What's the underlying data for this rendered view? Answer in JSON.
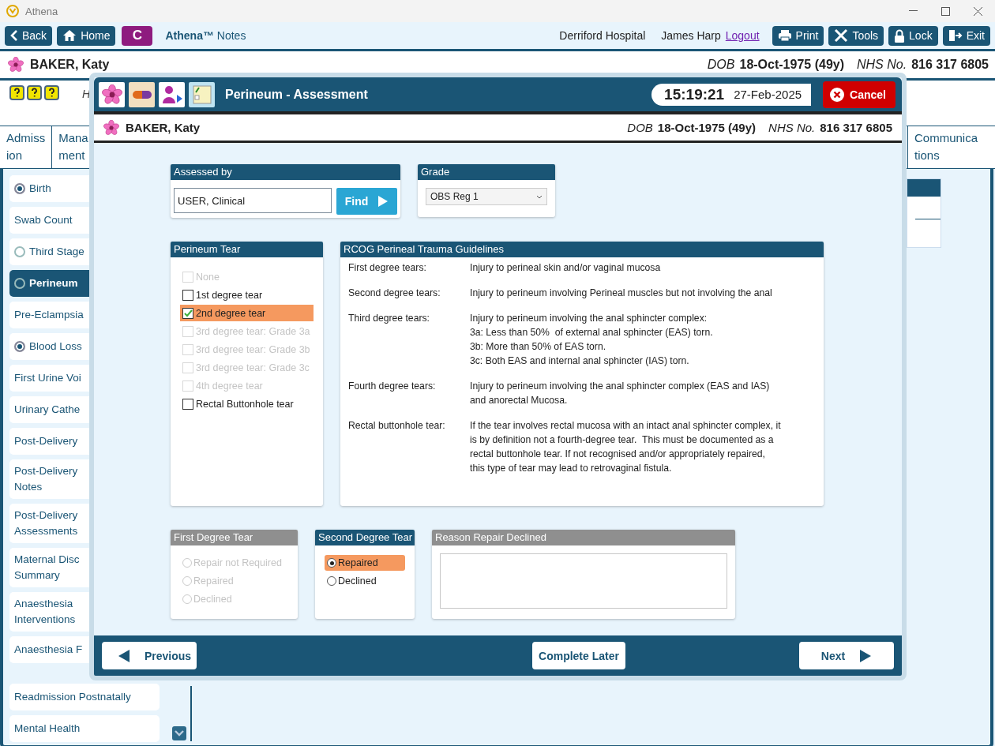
{
  "app_title": "Athena",
  "toolbar": {
    "nav_buttons": [
      {
        "label": "Back"
      },
      {
        "label": "Home"
      }
    ],
    "c_button": "C",
    "brand": "**Athena™** Notes",
    "hospital": "Derriford Hospital",
    "user": "James Harp",
    "logout": "Logout",
    "action_buttons": [
      {
        "label": "Print"
      },
      {
        "label": "Tools"
      },
      {
        "label": "Lock"
      },
      {
        "label": "Exit"
      }
    ]
  },
  "patient": {
    "name": "BAKER, Katy",
    "dob_label": "DOB",
    "dob": "18-Oct-1975 (49y)",
    "nhs_label": "NHS No.",
    "nhs": "816 317 6805"
  },
  "info_row": {
    "hint": "H"
  },
  "tabs": [
    {
      "lines": [
        "Admiss",
        "ion"
      ]
    },
    {
      "lines": [
        "Mana",
        "ment"
      ]
    },
    {
      "lines": [
        "Communica",
        "tions"
      ]
    }
  ],
  "sidebar": {
    "items": [
      {
        "lines": [
          "Birth"
        ],
        "checked": true,
        "selected": false
      },
      {
        "lines": [
          "Swab Count"
        ],
        "selected": false
      },
      {
        "lines": [
          "Third Stage"
        ],
        "checked": false,
        "selected": false
      },
      {
        "lines": [
          "Perineum"
        ],
        "checked": false,
        "selected": true
      },
      {
        "lines": [
          "Pre-Eclampsia"
        ],
        "selected": false
      },
      {
        "lines": [
          "Blood Loss"
        ],
        "checked": true,
        "selected": false
      },
      {
        "lines": [
          "First Urine Voi"
        ],
        "selected": false
      },
      {
        "lines": [
          "Urinary Cathe"
        ],
        "selected": false
      },
      {
        "lines": [
          "Post-Delivery"
        ],
        "selected": false
      },
      {
        "lines": [
          "Post-Delivery",
          "Notes"
        ],
        "selected": false
      },
      {
        "lines": [
          "Post-Delivery",
          "Assessments"
        ],
        "selected": false
      },
      {
        "lines": [
          "Maternal Disc",
          "Summary"
        ],
        "selected": false
      },
      {
        "lines": [
          "Anaesthesia",
          "Interventions"
        ],
        "selected": false
      },
      {
        "lines": [
          "Anaesthesia F"
        ],
        "selected": false
      },
      {
        "lines": [
          "Readmission Postnatally"
        ],
        "selected": false
      },
      {
        "lines": [
          "Mental Health"
        ],
        "selected": false
      }
    ]
  },
  "modal": {
    "title": "Perineum - Assessment",
    "time": "15:19:21",
    "date": "27-Feb-2025",
    "cancel": "Cancel",
    "patient": {
      "name": "BAKER, Katy",
      "dob_label": "DOB",
      "dob": "18-Oct-1975 (49y)",
      "nhs_label": "NHS No.",
      "nhs": "816 317 6805"
    },
    "assessed_by": {
      "header": "Assessed by",
      "value": "USER, Clinical",
      "find": "Find"
    },
    "grade": {
      "header": "Grade",
      "value": "OBS Reg 1"
    },
    "perineum_tear": {
      "header": "Perineum Tear",
      "options": [
        {
          "label": "None",
          "checked": false,
          "disabled": true
        },
        {
          "label": "1st degree tear",
          "checked": false,
          "disabled": false
        },
        {
          "label": "2nd degree tear",
          "checked": true,
          "disabled": false
        },
        {
          "label": "3rd degree tear: Grade 3a",
          "checked": false,
          "disabled": true
        },
        {
          "label": "3rd degree tear: Grade 3b",
          "checked": false,
          "disabled": true
        },
        {
          "label": "3rd degree tear: Grade 3c",
          "checked": false,
          "disabled": true
        },
        {
          "label": "4th degree tear",
          "checked": false,
          "disabled": true
        },
        {
          "label": "Rectal Buttonhole tear",
          "checked": false,
          "disabled": false
        }
      ]
    },
    "guidelines": {
      "header": "RCOG Perineal Trauma Guidelines",
      "rows": [
        {
          "term": "First degree tears:",
          "lines": [
            "Injury to perineal skin and/or vaginal mucosa"
          ]
        },
        {
          "term": "Second degree tears:",
          "lines": [
            "Injury to perineum involving Perineal muscles but not involving the anal"
          ]
        },
        {
          "term": "Third degree tears:",
          "lines": [
            "Injury to perineum involving the anal sphincter complex:",
            "3a: Less than 50%  of external anal sphincter (EAS) torn.",
            "3b: More than 50% of EAS torn.",
            "3c: Both EAS and internal anal sphincter (IAS) torn."
          ]
        },
        {
          "term": "Fourth degree tears:",
          "lines": [
            "Injury to perineum involving the anal sphincter complex (EAS and IAS)",
            "and anorectal Mucosa."
          ]
        },
        {
          "term": "Rectal buttonhole tear:",
          "lines": [
            "If the tear involves rectal mucosa with an intact anal sphincter complex, it",
            "is by definition not a fourth-degree tear.  This must be documented as a",
            "rectal buttonhole tear. If not recognised and/or appropriately repaired,",
            "this type of tear may lead to retrovaginal fistula."
          ]
        }
      ]
    },
    "first_degree": {
      "header": "First Degree Tear",
      "disabled": true,
      "options": [
        {
          "label": "Repair not Required",
          "selected": false
        },
        {
          "label": "Repaired",
          "selected": false
        },
        {
          "label": "Declined",
          "selected": false
        }
      ]
    },
    "second_degree": {
      "header": "Second Degree Tear",
      "disabled": false,
      "options": [
        {
          "label": "Repaired",
          "selected": true
        },
        {
          "label": "Declined",
          "selected": false
        }
      ]
    },
    "reason": {
      "header": "Reason Repair Declined",
      "disabled": true
    },
    "footer": {
      "previous": "Previous",
      "complete_later": "Complete Later",
      "next": "Next"
    }
  }
}
